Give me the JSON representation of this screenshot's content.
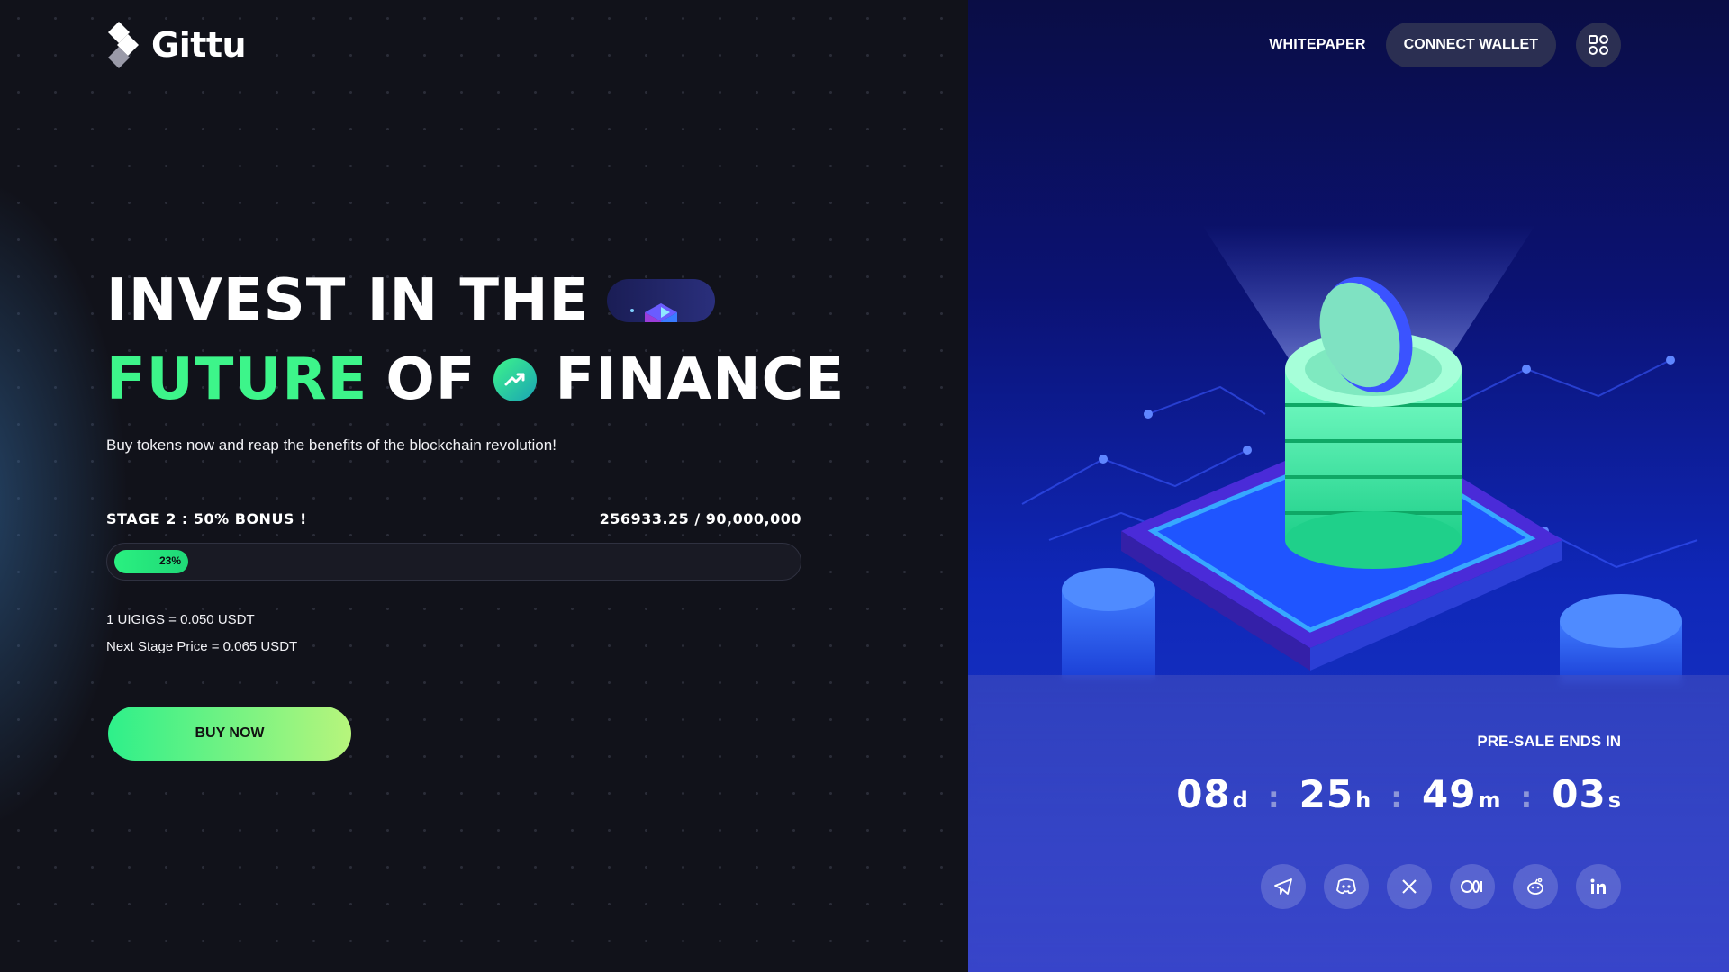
{
  "brand": {
    "name": "Gittu"
  },
  "nav": {
    "whitepaper": "WHITEPAPER",
    "connect_wallet": "CONNECT WALLET",
    "menu_icon": "grid-menu-icon"
  },
  "hero": {
    "line1": "INVEST IN THE",
    "line2_green": "FUTURE",
    "line2_mid": "OF",
    "line2_end": "FINANCE",
    "subtitle": "Buy tokens now and reap the benefits of the blockchain revolution!"
  },
  "sale": {
    "stage_label": "STAGE 2 :  50% BONUS !",
    "raised_label": "256933.25 / 90,000,000",
    "progress_percent": 23,
    "progress_text": "23%",
    "price_line": "1 UIGIGS = 0.050 USDT",
    "next_price_line": "Next Stage Price = 0.065 USDT",
    "buy_label": "BUY NOW"
  },
  "presale": {
    "label": "PRE-SALE ENDS IN",
    "days": "08",
    "days_unit": "d",
    "hours": "25",
    "hours_unit": "h",
    "minutes": "49",
    "minutes_unit": "m",
    "seconds": "03",
    "seconds_unit": "s",
    "separator": ":"
  },
  "socials": [
    "telegram-icon",
    "discord-icon",
    "x-icon",
    "medium-icon",
    "reddit-icon",
    "linkedin-icon"
  ],
  "colors": {
    "accent_green": "#3df58a",
    "panel_blue": "#0f27b8",
    "dark_bg": "#11121a"
  }
}
